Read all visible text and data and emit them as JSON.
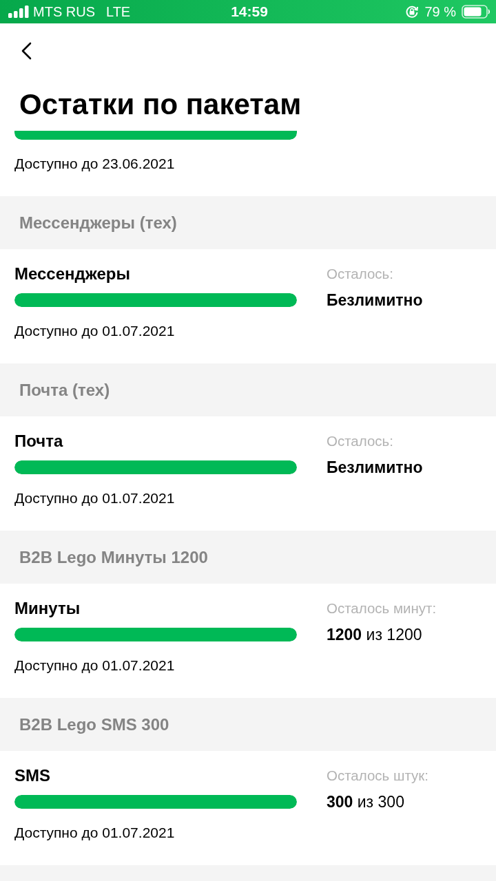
{
  "status_bar": {
    "carrier": "MTS RUS",
    "network": "LTE",
    "time": "14:59",
    "battery": "79 %"
  },
  "title": "Остатки по пакетам",
  "top_item": {
    "level": 1,
    "expires": "Доступно до 23.06.2021"
  },
  "groups": [
    {
      "title": "Мессенджеры (тех)",
      "items": [
        {
          "name": "Мессенджеры",
          "level": 1,
          "expires": "Доступно до 01.07.2021",
          "remaining_label": "Осталось:",
          "kind": "unlimited",
          "value": "Безлимитно"
        }
      ]
    },
    {
      "title": "Почта (тех)",
      "items": [
        {
          "name": "Почта",
          "level": 1,
          "expires": "Доступно до 01.07.2021",
          "remaining_label": "Осталось:",
          "kind": "unlimited",
          "value": "Безлимитно"
        }
      ]
    },
    {
      "title": "B2B Lego Минуты 1200",
      "items": [
        {
          "name": "Минуты",
          "level": 1,
          "expires": "Доступно до 01.07.2021",
          "remaining_label": "Осталось минут:",
          "kind": "count",
          "value": "**1200** из 1200"
        }
      ]
    },
    {
      "title": "B2B Lego SMS 300",
      "items": [
        {
          "name": "SMS",
          "level": 1,
          "expires": "Доступно до 01.07.2021",
          "remaining_label": "Осталось штук:",
          "kind": "count",
          "value": "**300** из 300"
        }
      ]
    }
  ]
}
